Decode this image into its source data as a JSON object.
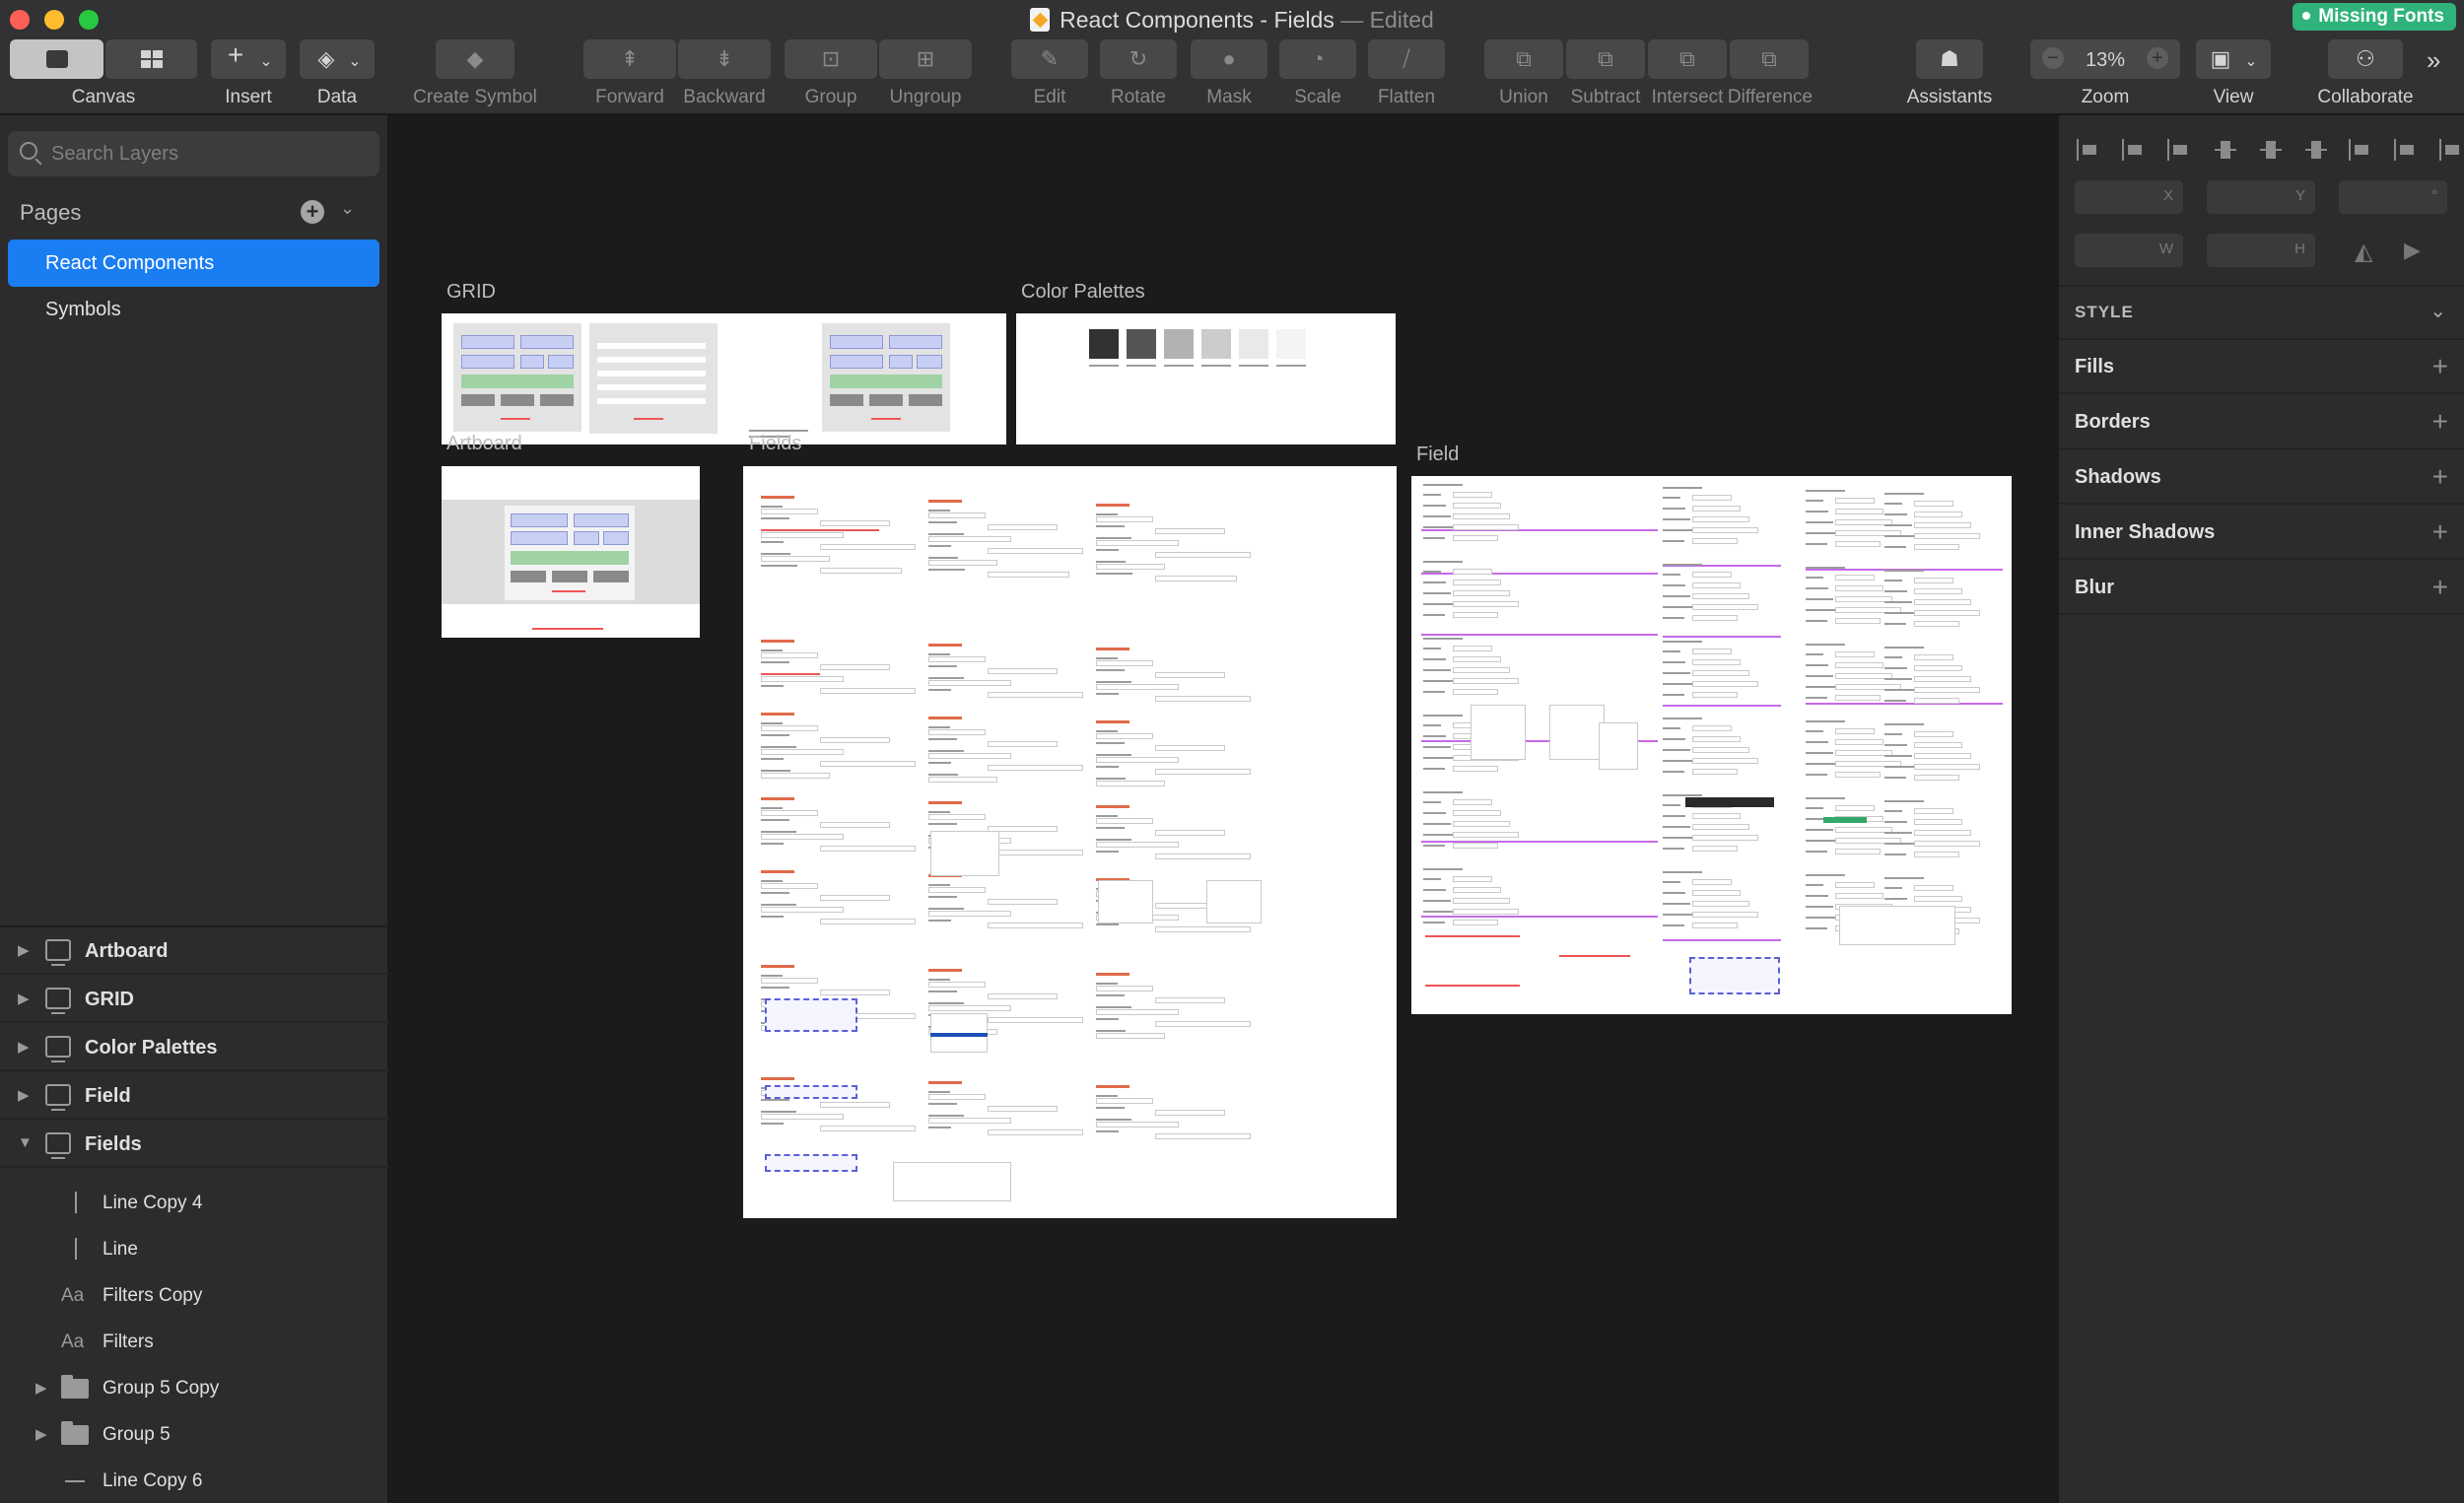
{
  "window": {
    "title": "React Components - Fields",
    "title_status": "— Edited",
    "missing_fonts": "Missing Fonts"
  },
  "toolbar": {
    "canvas": "Canvas",
    "insert": "Insert",
    "data": "Data",
    "create_symbol": "Create Symbol",
    "forward": "Forward",
    "backward": "Backward",
    "group": "Group",
    "ungroup": "Ungroup",
    "edit": "Edit",
    "rotate": "Rotate",
    "mask": "Mask",
    "scale": "Scale",
    "flatten": "Flatten",
    "union": "Union",
    "subtract": "Subtract",
    "intersect": "Intersect",
    "difference": "Difference",
    "assistants": "Assistants",
    "zoom_label": "Zoom",
    "zoom_value": "13%",
    "view": "View",
    "collaborate": "Collaborate"
  },
  "sidebar": {
    "search_placeholder": "Search Layers",
    "pages_title": "Pages",
    "pages": [
      {
        "label": "React Components",
        "selected": true
      },
      {
        "label": "Symbols",
        "selected": false
      }
    ],
    "artboards": [
      {
        "label": "Artboard",
        "expanded": false
      },
      {
        "label": "GRID",
        "expanded": false
      },
      {
        "label": "Color Palettes",
        "expanded": false
      },
      {
        "label": "Field",
        "expanded": false
      },
      {
        "label": "Fields",
        "expanded": true
      }
    ],
    "children": [
      {
        "label": "Line Copy 4",
        "icon": "vertical-line-icon"
      },
      {
        "label": "Line",
        "icon": "vertical-line-icon"
      },
      {
        "label": "Filters Copy",
        "icon": "text-icon",
        "icon_text": "Aa"
      },
      {
        "label": "Filters",
        "icon": "text-icon",
        "icon_text": "Aa"
      },
      {
        "label": "Group 5 Copy",
        "icon": "folder-icon"
      },
      {
        "label": "Group 5",
        "icon": "folder-icon"
      },
      {
        "label": "Line Copy 6",
        "icon": "horizontal-line-icon"
      }
    ]
  },
  "canvas": {
    "artboards": {
      "grid": "GRID",
      "color_palettes": "Color Palettes",
      "artboard": "Artboard",
      "fields": "Fields",
      "field": "Field"
    },
    "swatches": [
      "#323232",
      "#555555",
      "#b2b2b2",
      "#cccccc",
      "#e9e9e9",
      "#f4f4f4"
    ]
  },
  "inspector": {
    "fields": {
      "x": "X",
      "y": "Y",
      "rotation": "°",
      "w": "W",
      "h": "H"
    },
    "style_title": "STYLE",
    "sections": [
      "Fills",
      "Borders",
      "Shadows",
      "Inner Shadows",
      "Blur"
    ]
  },
  "colors": {
    "accent": "#1a7ef2",
    "missing_fonts_badge": "#2fb37a",
    "sidebar_bg": "#2c2c2e",
    "canvas_bg": "#1b1b1d"
  }
}
